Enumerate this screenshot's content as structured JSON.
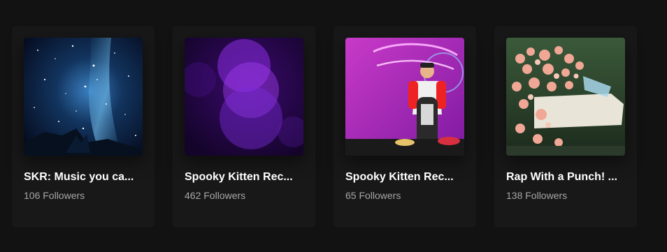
{
  "cards": [
    {
      "title": "SKR: Music you ca...",
      "subtitle": "106 Followers",
      "image": "galaxy-night-sky"
    },
    {
      "title": "Spooky Kitten Rec...",
      "subtitle": "462 Followers",
      "image": "purple-bokeh"
    },
    {
      "title": "Spooky Kitten Rec...",
      "subtitle": "65 Followers",
      "image": "neon-sign-jukebox"
    },
    {
      "title": "Rap With a Punch! ...",
      "subtitle": "138 Followers",
      "image": "flower-covered-car"
    }
  ],
  "colors": {
    "background": "#121212",
    "card": "#181818",
    "title": "#ffffff",
    "subtitle": "#a7a7a7"
  }
}
